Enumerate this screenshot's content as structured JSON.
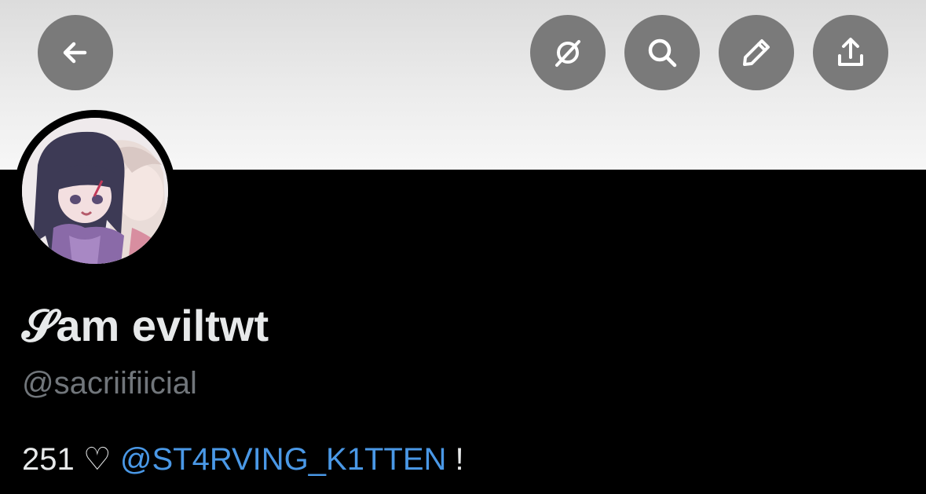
{
  "header": {
    "buttons": [
      {
        "name": "back",
        "icon": "arrow-left-icon"
      },
      {
        "name": "grok",
        "icon": "grok-icon"
      },
      {
        "name": "search",
        "icon": "search-icon"
      },
      {
        "name": "edit",
        "icon": "pencil-icon"
      },
      {
        "name": "share",
        "icon": "share-icon"
      }
    ]
  },
  "profile": {
    "display_name": "𝓢am eviltwt",
    "handle": "@sacriifiicial",
    "bio": {
      "count": "251",
      "heart": "♡",
      "mention": "@ST4RVING_K1TTEN",
      "suffix": "!"
    }
  },
  "colors": {
    "banner": "#ececec",
    "button_bg": "#7a7a7a",
    "background": "#000000",
    "text": "#e7e9ea",
    "secondary_text": "#71767b",
    "link": "#4a98e6"
  }
}
